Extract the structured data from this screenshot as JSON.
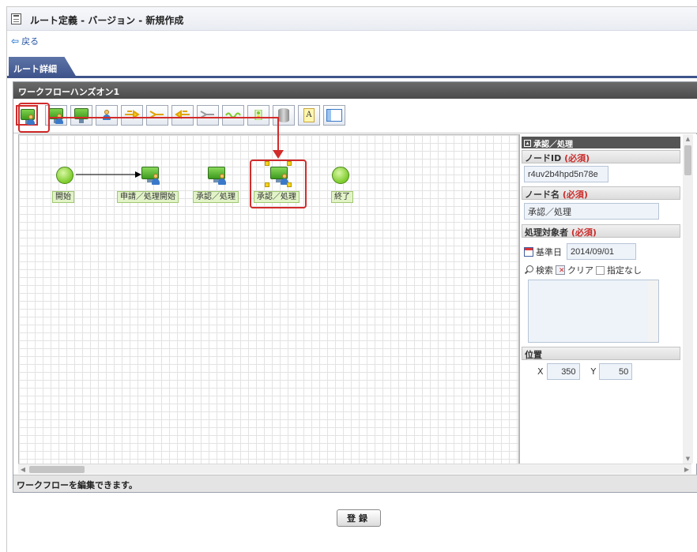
{
  "window": {
    "title": "ルート定義 - バージョン - 新規作成"
  },
  "nav": {
    "back_label": "戻る"
  },
  "tab": {
    "label": "ルート詳細"
  },
  "editor": {
    "title": "ワークフローハンズオン1",
    "status": "ワークフローを編集できます。",
    "toolbar_icons": [
      "approval-node-tool-icon",
      "application-node-tool-icon",
      "process-node-tool-icon",
      "user-node-tool-icon",
      "branch-tool-icon",
      "merge-tool-icon",
      "parallel-start-tool-icon",
      "parallel-end-tool-icon",
      "wait-tool-icon",
      "condition-tool-icon",
      "database-tool-icon",
      "text-tool-icon",
      "frame-tool-icon"
    ]
  },
  "nodes": {
    "start": "開始",
    "apply": "申請／処理開始",
    "approve1": "承認／処理",
    "approve2": "承認／処理",
    "end": "終了"
  },
  "props": {
    "panel_title": "承認／処理",
    "node_id_label": "ノードID",
    "required_mark": "(必須)",
    "node_id_value": "r4uv2b4hpd5n78e",
    "node_name_label": "ノード名",
    "node_name_value": "承認／処理",
    "target_label": "処理対象者",
    "base_date_label": "基準日",
    "base_date_value": "2014/09/01",
    "search_label": "検索",
    "clear_label": "クリア",
    "no_spec_label": "指定なし",
    "position_label": "位置",
    "x_label": "X",
    "x_value": "350",
    "y_label": "Y",
    "y_value": "50"
  },
  "footer": {
    "submit_label": "登録"
  },
  "colors": {
    "accent_tab": "#3e548b",
    "highlight_red": "#d22b2b",
    "node_green": "#7ccb2b"
  }
}
